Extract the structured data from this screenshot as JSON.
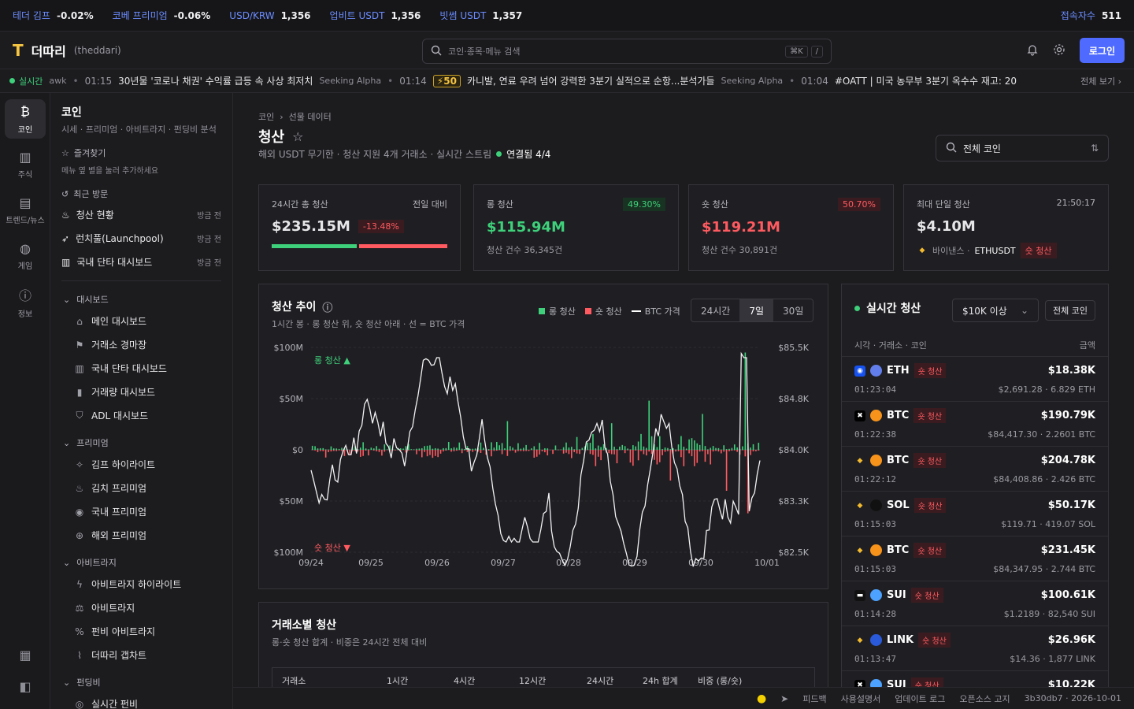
{
  "topbar": {
    "items": [
      {
        "label": "테더 김프",
        "value": "-0.02%"
      },
      {
        "label": "코베 프리미엄",
        "value": "-0.06%"
      },
      {
        "label": "USD/KRW",
        "value": "1,356"
      },
      {
        "label": "업비트 USDT",
        "value": "1,356"
      },
      {
        "label": "빗썸 USDT",
        "value": "1,357"
      }
    ],
    "users_label": "접속자수",
    "users_value": "511"
  },
  "header": {
    "logo_mark": "T",
    "brand": "더따리",
    "brand_sub": "(theddari)",
    "search_placeholder": "코인·종목·메뉴 검색",
    "kbd1": "⌘K",
    "kbd2": "/",
    "login": "로그인"
  },
  "ticker": {
    "live": "실시간",
    "lead": "awk",
    "items": [
      {
        "time": "01:15",
        "text": "30년물 '코로나 채권' 수익률 급등 속 사상 최저치",
        "source": "Seeking Alpha"
      },
      {
        "time": "01:14",
        "badge": "50",
        "text": "카니발, 연료 우려 넘어 강력한 3분기 실적으로 순항...분석가들",
        "source": "Seeking Alpha"
      },
      {
        "time": "01:04",
        "text": "#OATT | 미국 농무부 3분기 옥수수 재고: 20",
        "source": ""
      }
    ],
    "more": "전체 보기 ›"
  },
  "rail": [
    {
      "icon": "₿",
      "label": "코인",
      "active": true
    },
    {
      "icon": "▥",
      "label": "주식"
    },
    {
      "icon": "▤",
      "label": "트렌드/뉴스"
    },
    {
      "icon": "◍",
      "label": "게임"
    },
    {
      "icon": "ⓘ",
      "label": "정보"
    }
  ],
  "sidebar": {
    "title": "코인",
    "subtitle": "시세 · 프리미엄 · 아비트라지 · 펀딩비 분석",
    "fav_title": "즐겨찾기",
    "fav_hint": "메뉴 옆 별을 눌러 추가하세요",
    "recent_title": "최근 방문",
    "recent": [
      {
        "label": "청산 현황",
        "when": "방금 전"
      },
      {
        "label": "런치풀(Launchpool)",
        "when": "방금 전"
      },
      {
        "label": "국내 단타 대시보드",
        "when": "방금 전"
      }
    ],
    "groups": [
      {
        "title": "대시보드",
        "items": [
          "메인 대시보드",
          "거래소 경마장",
          "국내 단타 대시보드",
          "거래량 대시보드",
          "ADL 대시보드"
        ]
      },
      {
        "title": "프리미엄",
        "items": [
          "김프 하이라이트",
          "김치 프리미엄",
          "국내 프리미엄",
          "해외 프리미엄"
        ]
      },
      {
        "title": "아비트라지",
        "items": [
          "아비트라지 하이라이트",
          "아비트라지",
          "펀비 아비트라지",
          "더따리 갭차트"
        ]
      },
      {
        "title": "펀딩비",
        "items": [
          "실시간 펀비"
        ]
      }
    ]
  },
  "page": {
    "crumb1": "코인",
    "crumb2": "선물 데이터",
    "title": "청산",
    "desc": "해외 USDT 무기한 · 청산 지원 4개 거래소 · 실시간 스트림",
    "status": "연결됨 4/4",
    "coin_select": "전체 코인"
  },
  "cards": [
    {
      "title": "24시간 총 청산",
      "right": "전일 대비",
      "value": "$235.15M",
      "pill": "-13.48%"
    },
    {
      "title": "롱 청산",
      "pill": "49.30%",
      "value": "$115.94M",
      "sub": "청산 건수 36,345건"
    },
    {
      "title": "숏 청산",
      "pill": "50.70%",
      "value": "$119.21M",
      "sub": "청산 건수 30,891건"
    },
    {
      "title": "최대 단일 청산",
      "right": "21:50:17",
      "value": "$4.10M",
      "exchange": "바이낸스 ·",
      "symbol": "ETHUSDT",
      "tag": "숏 청산"
    }
  ],
  "trend": {
    "title": "청산 추이",
    "subtitle": "1시간 봉 · 롱 청산 위, 숏 청산 아래 · 선 = BTC 가격",
    "legend": [
      "롱 청산",
      "숏 청산",
      "BTC 가격"
    ],
    "ranges": [
      "24시간",
      "7일",
      "30일"
    ],
    "selected_range": "7일",
    "long_label": "롱 청산 ▲",
    "short_label": "숏 청산 ▼"
  },
  "chart_data": {
    "type": "bar",
    "title": "청산 추이",
    "x_ticks": [
      "09/24",
      "09/25",
      "09/26",
      "09/27",
      "09/28",
      "09/29",
      "09/30",
      "10/01"
    ],
    "y_left_ticks": [
      "$100M",
      "$50M",
      "$0",
      "$50M",
      "$100M"
    ],
    "y_left_range": [
      -100,
      100
    ],
    "y_right_ticks": [
      "$85.5K",
      "$84.8K",
      "$84.0K",
      "$83.3K",
      "$82.5K"
    ],
    "y_right_range": [
      82.5,
      85.5
    ],
    "series": [
      {
        "name": "롱 청산",
        "color": "#3ed07a",
        "peaks": [
          {
            "x": "09/26",
            "value": 28
          },
          {
            "x": "09/28",
            "value": 26
          },
          {
            "x": "09/29",
            "value": 48
          },
          {
            "x": "09/30",
            "value": 35
          },
          {
            "x": "10/01",
            "value": 95
          }
        ]
      },
      {
        "name": "숏 청산",
        "color": "#ff5a60",
        "peaks": [
          {
            "x": "09/26",
            "value": -25
          },
          {
            "x": "09/29",
            "value": -30
          },
          {
            "x": "09/30",
            "value": -40
          },
          {
            "x": "10/01",
            "value": -62
          }
        ]
      },
      {
        "name": "BTC 가격",
        "color": "#ffffff"
      }
    ],
    "grid": true,
    "legend_position": "top-right"
  },
  "exchange_table": {
    "title": "거래소별 청산",
    "subtitle": "롱·숏 청산 합계 · 비중은 24시간 전체 대비",
    "columns": [
      "거래소",
      "1시간",
      "4시간",
      "12시간",
      "24시간",
      "24h 합계",
      "비중 (롱/숏)"
    ]
  },
  "live": {
    "title": "실시간 청산",
    "filter": "$10K 이상",
    "coin_filter": "전체 코인",
    "col_left": "시각 · 거래소 · 코인",
    "col_right": "금액",
    "rows": [
      {
        "ex": "coinbase",
        "coin": "ETH",
        "tag": "숏 청산",
        "amount": "$18.38K",
        "time": "01:23:04",
        "detail": "$2,691.28 · 6.829 ETH"
      },
      {
        "ex": "okx",
        "coin": "BTC",
        "tag": "숏 청산",
        "amount": "$190.79K",
        "time": "01:22:38",
        "detail": "$84,417.30 · 2.2601 BTC"
      },
      {
        "ex": "binance",
        "coin": "BTC",
        "tag": "숏 청산",
        "amount": "$204.78K",
        "time": "01:22:12",
        "detail": "$84,408.86 · 2.426 BTC"
      },
      {
        "ex": "binance",
        "coin": "SOL",
        "tag": "숏 청산",
        "amount": "$50.17K",
        "time": "01:15:03",
        "detail": "$119.71 · 419.07 SOL"
      },
      {
        "ex": "binance",
        "coin": "BTC",
        "tag": "숏 청산",
        "amount": "$231.45K",
        "time": "01:15:03",
        "detail": "$84,347.95 · 2.744 BTC"
      },
      {
        "ex": "bybit",
        "coin": "SUI",
        "tag": "숏 청산",
        "amount": "$100.61K",
        "time": "01:14:28",
        "detail": "$1.2189 · 82,540 SUI"
      },
      {
        "ex": "binance",
        "coin": "LINK",
        "tag": "숏 청산",
        "amount": "$26.96K",
        "time": "01:13:47",
        "detail": "$14.36 · 1,877 LINK"
      },
      {
        "ex": "okx",
        "coin": "SUI",
        "tag": "숏 청산",
        "amount": "$10.22K",
        "time": "",
        "detail": ""
      }
    ]
  },
  "footer": [
    "피드백",
    "사용설명서",
    "업데이트 로그",
    "오픈소스 고지",
    "3b30db7 · 2026-10-01"
  ]
}
